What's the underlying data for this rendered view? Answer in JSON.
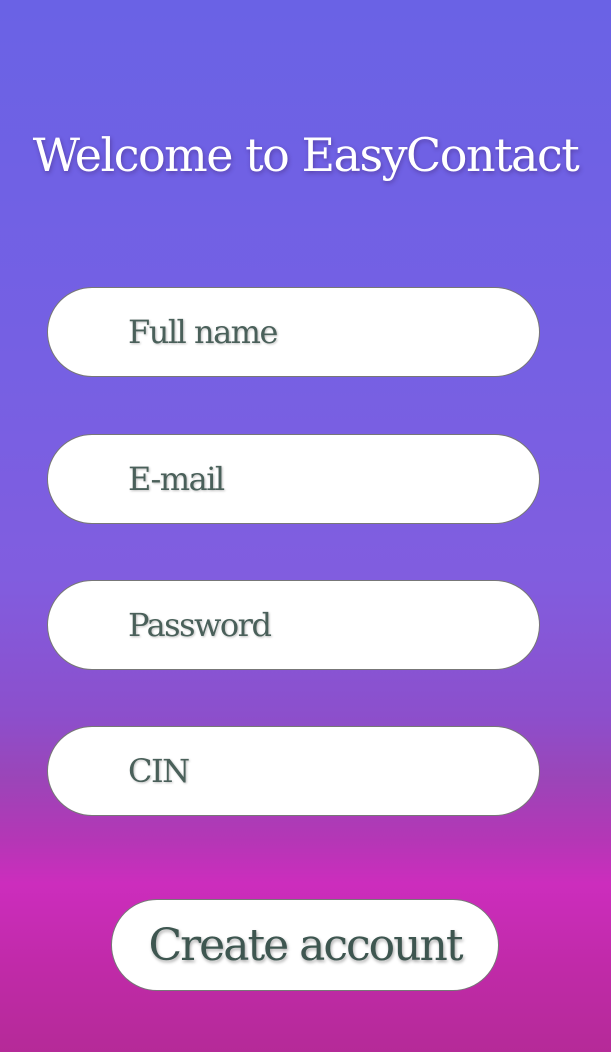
{
  "header": {
    "title": "Welcome to EasyContact"
  },
  "form": {
    "fields": [
      {
        "placeholder": "Full name",
        "value": ""
      },
      {
        "placeholder": "E-mail",
        "value": ""
      },
      {
        "placeholder": "Password",
        "value": ""
      },
      {
        "placeholder": "CIN",
        "value": ""
      }
    ],
    "submit_label": "Create account"
  },
  "colors": {
    "gradient_top": "#6a62e5",
    "gradient_mid": "#815ddf",
    "gradient_bottom": "#cc2dbd",
    "text_dark": "#3e5650",
    "field_bg": "#ffffff"
  }
}
